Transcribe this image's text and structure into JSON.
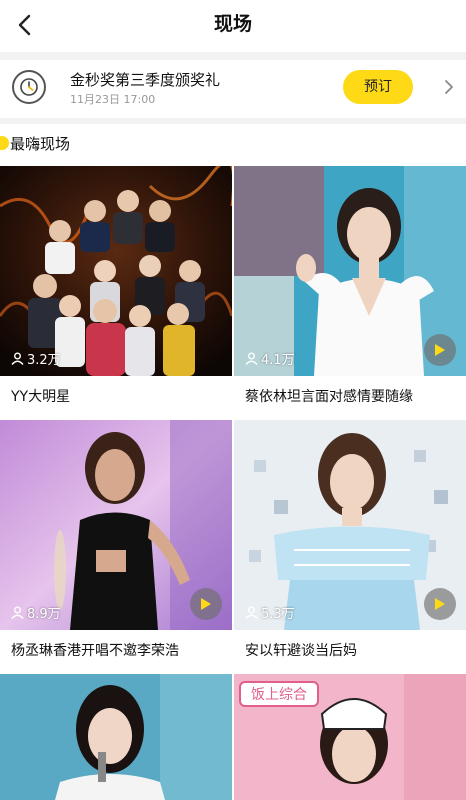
{
  "header": {
    "title": "现场"
  },
  "event": {
    "title": "金秒奖第三季度颁奖礼",
    "time": "11月23日 17:00",
    "reserve_label": "预订"
  },
  "section": {
    "title": "最嗨现场"
  },
  "cards": [
    {
      "views": "3.2万",
      "caption": "YY大明星"
    },
    {
      "views": "4.1万",
      "caption": "蔡依林坦言面对感情要随缘"
    },
    {
      "views": "8.9万",
      "caption": "杨丞琳香港开唱不邀李荣浩"
    },
    {
      "views": "5.3万",
      "caption": "安以轩避谈当后妈"
    },
    {
      "views": "",
      "caption": ""
    },
    {
      "views": "",
      "caption": ""
    }
  ],
  "banners": {
    "food_show": "饭上综合"
  },
  "colors": {
    "accent": "#fdd916",
    "background": "#f2f2f2"
  },
  "icons": [
    "back-arrow-icon",
    "clock-icon",
    "chevron-right-icon",
    "person-icon",
    "play-icon"
  ]
}
